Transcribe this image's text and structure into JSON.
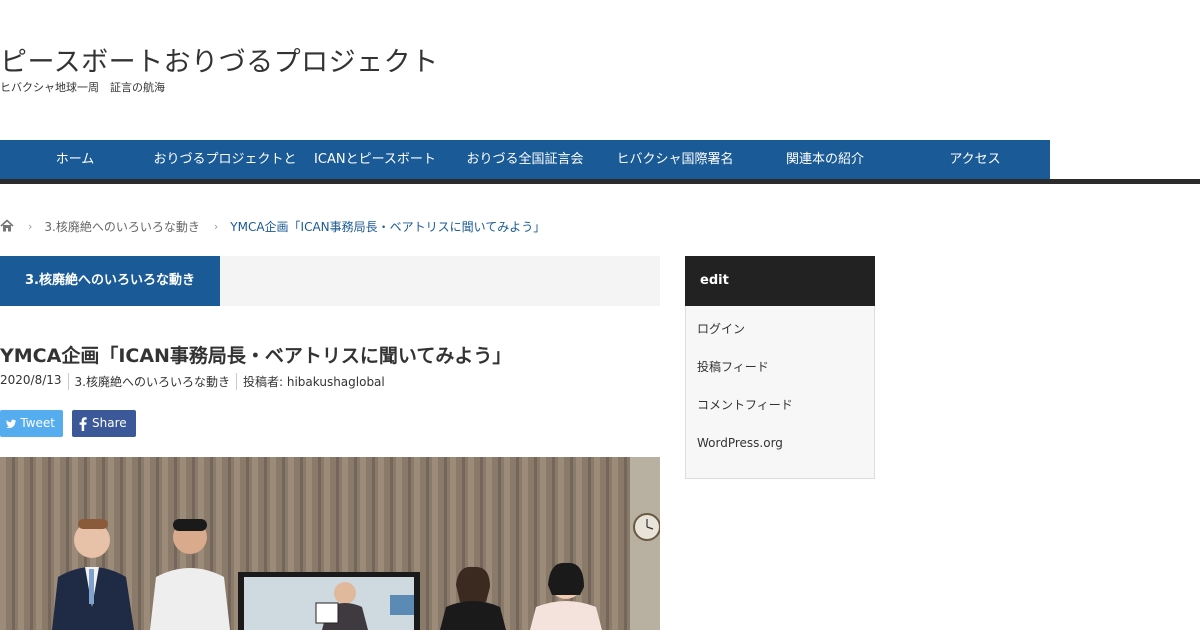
{
  "site": {
    "title": "ピースボートおりづるプロジェクト",
    "description": "ヒバクシャ地球一周　証言の航海"
  },
  "nav": {
    "items": [
      {
        "label": "ホーム"
      },
      {
        "label": "おりづるプロジェクトと"
      },
      {
        "label": "ICANとピースボート"
      },
      {
        "label": "おりづる全国証言会"
      },
      {
        "label": "ヒバクシャ国際署名"
      },
      {
        "label": "関連本の紹介"
      },
      {
        "label": "アクセス"
      }
    ]
  },
  "breadcrumb": {
    "category": "3.核廃絶へのいろいろな動き",
    "current": "YMCA企画「ICAN事務局長・ベアトリスに聞いてみよう」"
  },
  "category_bar": {
    "label": "3.核廃絶へのいろいろな動き"
  },
  "post": {
    "title": "YMCA企画「ICAN事務局長・ベアトリスに聞いてみよう」",
    "date": "2020/8/13",
    "category": "3.核廃絶へのいろいろな動き",
    "author": "投稿者: hibakushaglobal"
  },
  "share": {
    "tweet_label": "Tweet",
    "facebook_label": "Share"
  },
  "widget": {
    "title": "edit",
    "items": [
      {
        "label": "ログイン"
      },
      {
        "label": "投稿フィード"
      },
      {
        "label": "コメントフィード"
      },
      {
        "label": "WordPress.org"
      }
    ]
  },
  "colors": {
    "brand": "#1a5a96",
    "twitter": "#55acee",
    "facebook": "#3b5998",
    "widget_header": "#222222"
  }
}
